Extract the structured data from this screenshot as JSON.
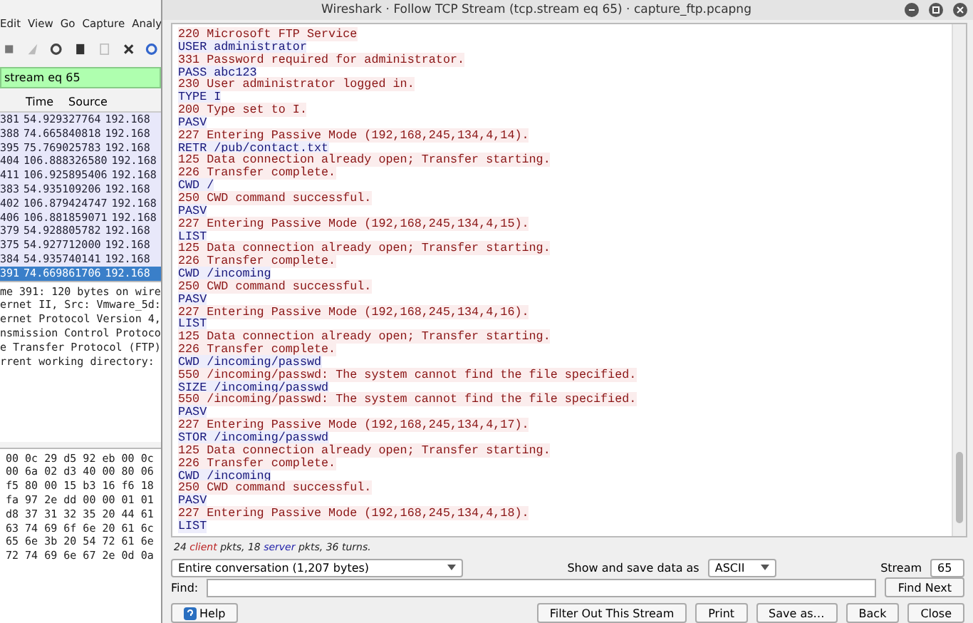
{
  "main_window": {
    "menu": [
      "Edit",
      "View",
      "Go",
      "Capture",
      "Analy"
    ],
    "filter": "stream eq 65",
    "columns": [
      "Time",
      "Source"
    ],
    "packets": [
      {
        "no": "381",
        "time": "54.929327764",
        "source": "192.168",
        "selected": false
      },
      {
        "no": "388",
        "time": "74.665840818",
        "source": "192.168",
        "selected": false
      },
      {
        "no": "395",
        "time": "75.769025783",
        "source": "192.168",
        "selected": false
      },
      {
        "no": "404",
        "time": "106.888326580",
        "source": "192.168",
        "selected": false
      },
      {
        "no": "411",
        "time": "106.925895406",
        "source": "192.168",
        "selected": false
      },
      {
        "no": "383",
        "time": "54.935109206",
        "source": "192.168",
        "selected": false
      },
      {
        "no": "402",
        "time": "106.879424747",
        "source": "192.168",
        "selected": false
      },
      {
        "no": "406",
        "time": "106.881859071",
        "source": "192.168",
        "selected": false
      },
      {
        "no": "379",
        "time": "54.928805782",
        "source": "192.168",
        "selected": false
      },
      {
        "no": "375",
        "time": "54.927712000",
        "source": "192.168",
        "selected": false
      },
      {
        "no": "384",
        "time": "54.935740141",
        "source": "192.168",
        "selected": false
      },
      {
        "no": "391",
        "time": "74.669861706",
        "source": "192.168",
        "selected": true
      }
    ],
    "details": [
      "me 391: 120 bytes on wire",
      "ernet II, Src: Vmware_5d:",
      "ernet Protocol Version 4,",
      "nsmission Control Protoco",
      "e Transfer Protocol (FTP)",
      "rrent working directory:"
    ],
    "hex": [
      "00 0c 29 d5 92 eb 00 0c",
      "00 6a 02 d3 40 00 80 06",
      "f5 80 00 15 b3 16 f6 18",
      "fa 97 2e dd 00 00 01 01",
      "d8 37 31 32 35 20 44 61",
      "63 74 69 6f 6e 20 61 6c",
      "65 6e 3b 20 54 72 61 6e",
      "72 74 69 6e 67 2e 0d 0a"
    ]
  },
  "dialog": {
    "title": "Wireshark · Follow TCP Stream (tcp.stream eq 65) · capture_ftp.pcapng",
    "stream": [
      {
        "kind": "server",
        "text": "220 Microsoft FTP Service"
      },
      {
        "kind": "client",
        "text": "USER administrator"
      },
      {
        "kind": "server",
        "text": "331 Password required for administrator."
      },
      {
        "kind": "client",
        "text": "PASS abc123"
      },
      {
        "kind": "server",
        "text": "230 User administrator logged in."
      },
      {
        "kind": "client",
        "text": "TYPE I"
      },
      {
        "kind": "server",
        "text": "200 Type set to I."
      },
      {
        "kind": "client",
        "text": "PASV"
      },
      {
        "kind": "server",
        "text": "227 Entering Passive Mode (192,168,245,134,4,14)."
      },
      {
        "kind": "client",
        "text": "RETR /pub/contact.txt"
      },
      {
        "kind": "server",
        "text": "125 Data connection already open; Transfer starting."
      },
      {
        "kind": "server",
        "text": "226 Transfer complete."
      },
      {
        "kind": "client",
        "text": "CWD /"
      },
      {
        "kind": "server",
        "text": "250 CWD command successful."
      },
      {
        "kind": "client",
        "text": "PASV"
      },
      {
        "kind": "server",
        "text": "227 Entering Passive Mode (192,168,245,134,4,15)."
      },
      {
        "kind": "client",
        "text": "LIST"
      },
      {
        "kind": "server",
        "text": "125 Data connection already open; Transfer starting."
      },
      {
        "kind": "server",
        "text": "226 Transfer complete."
      },
      {
        "kind": "client",
        "text": "CWD /incoming"
      },
      {
        "kind": "server",
        "text": "250 CWD command successful."
      },
      {
        "kind": "client",
        "text": "PASV"
      },
      {
        "kind": "server",
        "text": "227 Entering Passive Mode (192,168,245,134,4,16)."
      },
      {
        "kind": "client",
        "text": "LIST"
      },
      {
        "kind": "server",
        "text": "125 Data connection already open; Transfer starting."
      },
      {
        "kind": "server",
        "text": "226 Transfer complete."
      },
      {
        "kind": "client",
        "text": "CWD /incoming/passwd"
      },
      {
        "kind": "server",
        "text": "550 /incoming/passwd: The system cannot find the file specified."
      },
      {
        "kind": "client",
        "text": "SIZE /incoming/passwd"
      },
      {
        "kind": "server",
        "text": "550 /incoming/passwd: The system cannot find the file specified."
      },
      {
        "kind": "client",
        "text": "PASV"
      },
      {
        "kind": "server",
        "text": "227 Entering Passive Mode (192,168,245,134,4,17)."
      },
      {
        "kind": "client",
        "text": "STOR /incoming/passwd"
      },
      {
        "kind": "server",
        "text": "125 Data connection already open; Transfer starting."
      },
      {
        "kind": "server",
        "text": "226 Transfer complete."
      },
      {
        "kind": "client",
        "text": "CWD /incoming"
      },
      {
        "kind": "server",
        "text": "250 CWD command successful."
      },
      {
        "kind": "client",
        "text": "PASV"
      },
      {
        "kind": "server",
        "text": "227 Entering Passive Mode (192,168,245,134,4,18)."
      },
      {
        "kind": "client",
        "text": "LIST"
      }
    ],
    "summary": [
      {
        "kind": "plain",
        "text": "24 "
      },
      {
        "kind": "client",
        "text": "client"
      },
      {
        "kind": "plain",
        "text": " pkts, 18 "
      },
      {
        "kind": "server",
        "text": "server"
      },
      {
        "kind": "plain",
        "text": " pkts, 36 turns."
      }
    ],
    "conversation": "Entire conversation (1,207 bytes)",
    "show_as_label": "Show and save data as",
    "show_as": "ASCII",
    "stream_label": "Stream",
    "stream_number": "65",
    "find_label": "Find:",
    "find_next": "Find Next",
    "buttons": [
      "Help",
      "Filter Out This Stream",
      "Print",
      "Save as…",
      "Back",
      "Close"
    ]
  }
}
